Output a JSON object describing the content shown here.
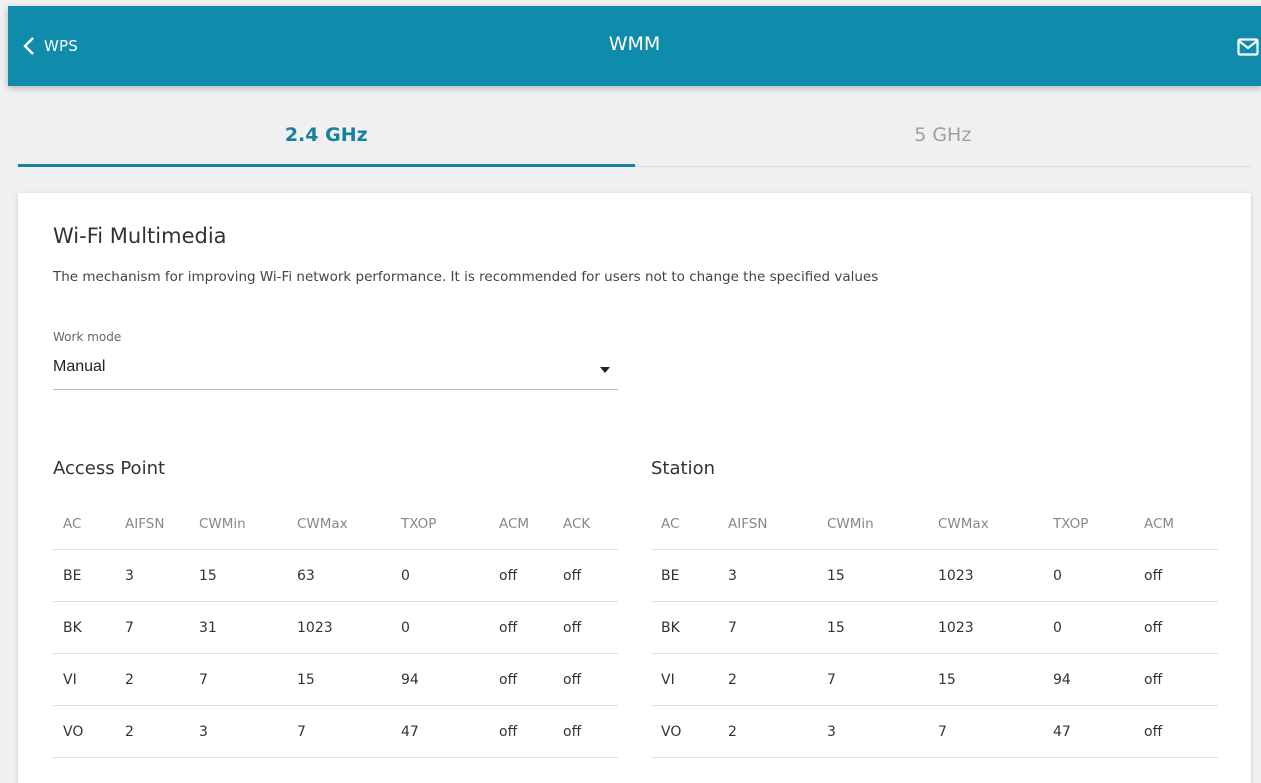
{
  "header": {
    "back_label": "WPS",
    "title": "WMM"
  },
  "tabs": [
    {
      "label": "2.4 GHz",
      "active": true
    },
    {
      "label": "5 GHz",
      "active": false
    }
  ],
  "card": {
    "title": "Wi-Fi Multimedia",
    "description": "The mechanism for improving Wi-Fi network performance. It is recommended for users not to change the specified values",
    "work_mode": {
      "label": "Work mode",
      "value": "Manual"
    }
  },
  "access_point": {
    "title": "Access Point",
    "columns": [
      "AC",
      "AIFSN",
      "CWMin",
      "CWMax",
      "TXOP",
      "ACM",
      "ACK"
    ],
    "rows": [
      [
        "BE",
        "3",
        "15",
        "63",
        "0",
        "off",
        "off"
      ],
      [
        "BK",
        "7",
        "31",
        "1023",
        "0",
        "off",
        "off"
      ],
      [
        "VI",
        "2",
        "7",
        "15",
        "94",
        "off",
        "off"
      ],
      [
        "VO",
        "2",
        "3",
        "7",
        "47",
        "off",
        "off"
      ]
    ]
  },
  "station": {
    "title": "Station",
    "columns": [
      "AC",
      "AIFSN",
      "CWMin",
      "CWMax",
      "TXOP",
      "ACM"
    ],
    "rows": [
      [
        "BE",
        "3",
        "15",
        "1023",
        "0",
        "off"
      ],
      [
        "BK",
        "7",
        "15",
        "1023",
        "0",
        "off"
      ],
      [
        "VI",
        "2",
        "7",
        "15",
        "94",
        "off"
      ],
      [
        "VO",
        "2",
        "3",
        "7",
        "47",
        "off"
      ]
    ]
  },
  "colors": {
    "header_bg": "#0f8bab",
    "accent": "#1680a1"
  }
}
